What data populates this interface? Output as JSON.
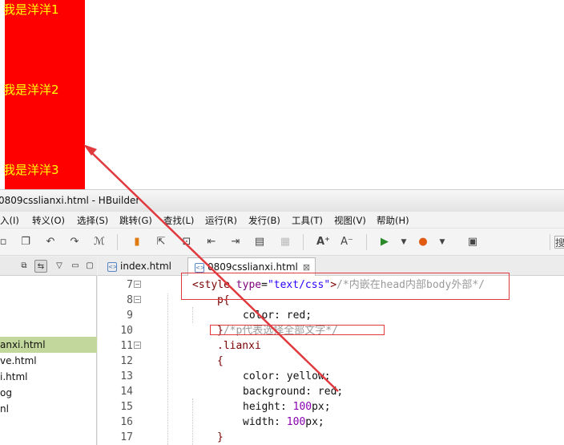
{
  "preview": {
    "boxes": [
      {
        "text": "我是洋洋1"
      },
      {
        "text": "我是洋洋2"
      },
      {
        "text": "我是洋洋3"
      }
    ]
  },
  "window": {
    "title": "0809csslianxi.html  -  HBuilder"
  },
  "menubar": {
    "items": [
      "入(I)",
      "转义(O)",
      "选择(S)",
      "跳转(G)",
      "查找(L)",
      "运行(R)",
      "发行(B)",
      "工具(T)",
      "视图(V)",
      "帮助(H)"
    ],
    "search_stub": "搜"
  },
  "toolbar": {
    "icons": [
      "open-file-icon",
      "copy-icon",
      "undo-icon",
      "redo-icon",
      "format-icon",
      "bookmark-icon",
      "export-icon",
      "save-all-icon",
      "move-left-icon",
      "move-right-icon",
      "comment-icon",
      "disabled-icon",
      "font-increase-icon",
      "font-decrease-icon",
      "run-icon",
      "dropdown-icon",
      "firefox-icon",
      "dropdown-icon",
      "info-icon"
    ]
  },
  "project": {
    "files": [
      {
        "name": "anxi.html",
        "selected": true
      },
      {
        "name": "ve.html",
        "selected": false
      },
      {
        "name": "i.html",
        "selected": false
      },
      {
        "name": "og",
        "selected": false
      },
      {
        "name": "nl",
        "selected": false
      }
    ]
  },
  "editor": {
    "tabs": [
      {
        "label": "index.html",
        "active": false
      },
      {
        "label": "0809csslianxi.html",
        "active": true,
        "close": "⊠"
      }
    ],
    "line_numbers": [
      "7",
      "8",
      "9",
      "10",
      "11",
      "12",
      "13",
      "14",
      "15",
      "16",
      "17"
    ],
    "lines": {
      "l7": {
        "open": "<style",
        "attr": " type",
        "eq": "=",
        "val": "\"text/css\"",
        "close": ">",
        "comment": "/*内嵌在head内部body外部*/"
      },
      "l8": {
        "text": "p{"
      },
      "l9": {
        "text": "color: red;"
      },
      "l10": {
        "text": "}",
        "comment": "/*p代表选择全部文字*/"
      },
      "l11": {
        "text": ".lianxi"
      },
      "l12": {
        "text": "{"
      },
      "l13": {
        "text": "color: yellow;"
      },
      "l14": {
        "text": "background: red;"
      },
      "l15": {
        "prop": "height: ",
        "num": "100",
        "unit": "px;"
      },
      "l16": {
        "prop": "width: ",
        "num": "100",
        "unit": "px;"
      },
      "l17": {
        "text": "}"
      }
    }
  },
  "colors": {
    "box_bg": "#ff0000",
    "box_text": "#ffff00",
    "annotation": "#e0393e",
    "selected_file": "#c2d79b"
  }
}
